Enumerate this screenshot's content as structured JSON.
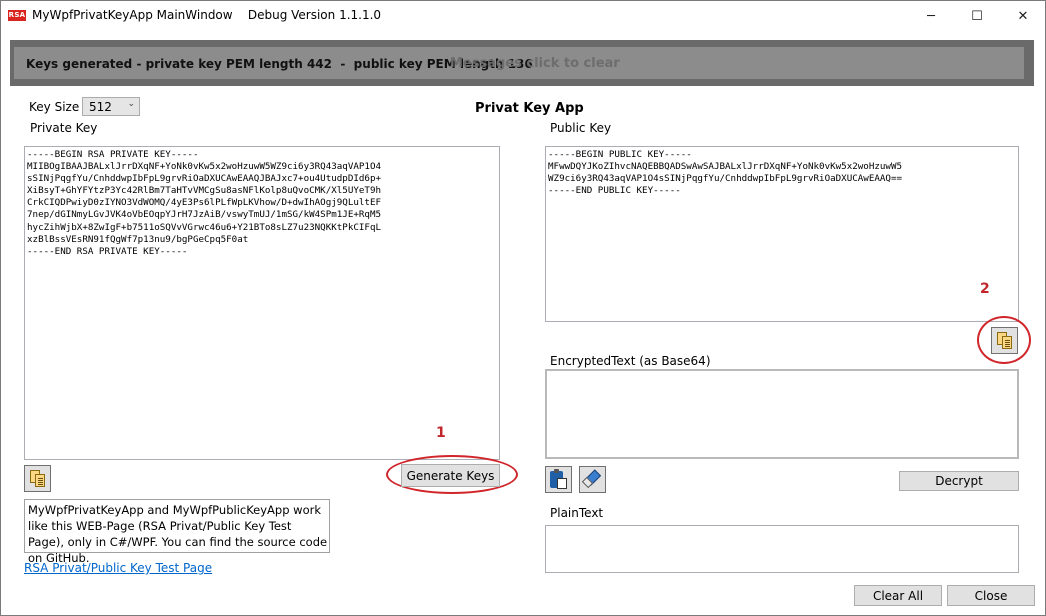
{
  "titlebar": {
    "app_icon_text": "RSA",
    "title": "MyWpfPrivatKeyApp MainWindow    Debug Version 1.1.1.0",
    "minimize": "─",
    "maximize": "☐",
    "close": "✕"
  },
  "message": {
    "text": "Keys generated - private key PEM length 442  -  public key PEM length 136",
    "hint": "Messages click to clear"
  },
  "key_size": {
    "label": "Key Size",
    "value": "512",
    "arrow": "⌄"
  },
  "app_heading": "Privat Key App",
  "private_key": {
    "label": "Private Key",
    "text": "-----BEGIN RSA PRIVATE KEY-----\nMIIBOgIBAAJBALxlJrrDXqNF+YoNk0vKw5x2woHzuwW5WZ9ci6y3RQ43aqVAP1O4\nsSINjPqgfYu/CnhddwpIbFpL9grvRiOaDXUCAwEAAQJBAJxc7+ou4UtudpDId6p+\nXiBsyT+GhYFYtzP3Yc42RlBm7TaHTvVMCgSu8asNFlKolp8uQvoCMK/Xl5UYeT9h\nCrkCIQDPwiyD0zIYNO3VdWOMQ/4yE3Ps6lPLfWpLKVhow/D+dwIhAOgj9QLultEF\n7nep/dGINmyLGvJVK4oVbEOqpYJrH7JzAiB/vswyTmUJ/1mSG/kW4SPm1JE+RqM5\nhycZihWjbX+8ZwIgF+b7511oSQVvVGrwc46u6+Y21BTo8sLZ7u23NQKKtPkCIFqL\nxzBlBssVEsRN91fQgWf7p13nu9/bgPGeCpq5F0at\n-----END RSA PRIVATE KEY-----",
    "copy_icon": "copy-icon"
  },
  "public_key": {
    "label": "Public Key",
    "text": "-----BEGIN PUBLIC KEY-----\nMFwwDQYJKoZIhvcNAQEBBQADSwAwSAJBALxlJrrDXqNF+YoNk0vKw5x2woHzuwW5\nWZ9ci6y3RQ43aqVAP1O4sSINjPqgfYu/CnhddwpIbFpL9grvRiOaDXUCAwEAAQ==\n-----END PUBLIC KEY-----",
    "copy_icon": "copy-icon"
  },
  "annotations": {
    "one": "1",
    "two": "2",
    "color": "#d0262b"
  },
  "buttons": {
    "generate": "Generate Keys",
    "decrypt": "Decrypt",
    "clear_all": "Clear All",
    "close": "Close"
  },
  "encrypted": {
    "label": "EncryptedText (as Base64)",
    "value": "",
    "paste_icon": "paste-icon",
    "eraser_icon": "eraser-icon"
  },
  "plaintext": {
    "label": "PlainText",
    "value": ""
  },
  "info_text": "MyWpfPrivatKeyApp and MyWpfPublicKeyApp work like this WEB-Page (RSA Privat/Public Key Test Page), only in C#/WPF. You can find the source code on GitHub.",
  "link_text": "RSA Privat/Public Key Test Page"
}
